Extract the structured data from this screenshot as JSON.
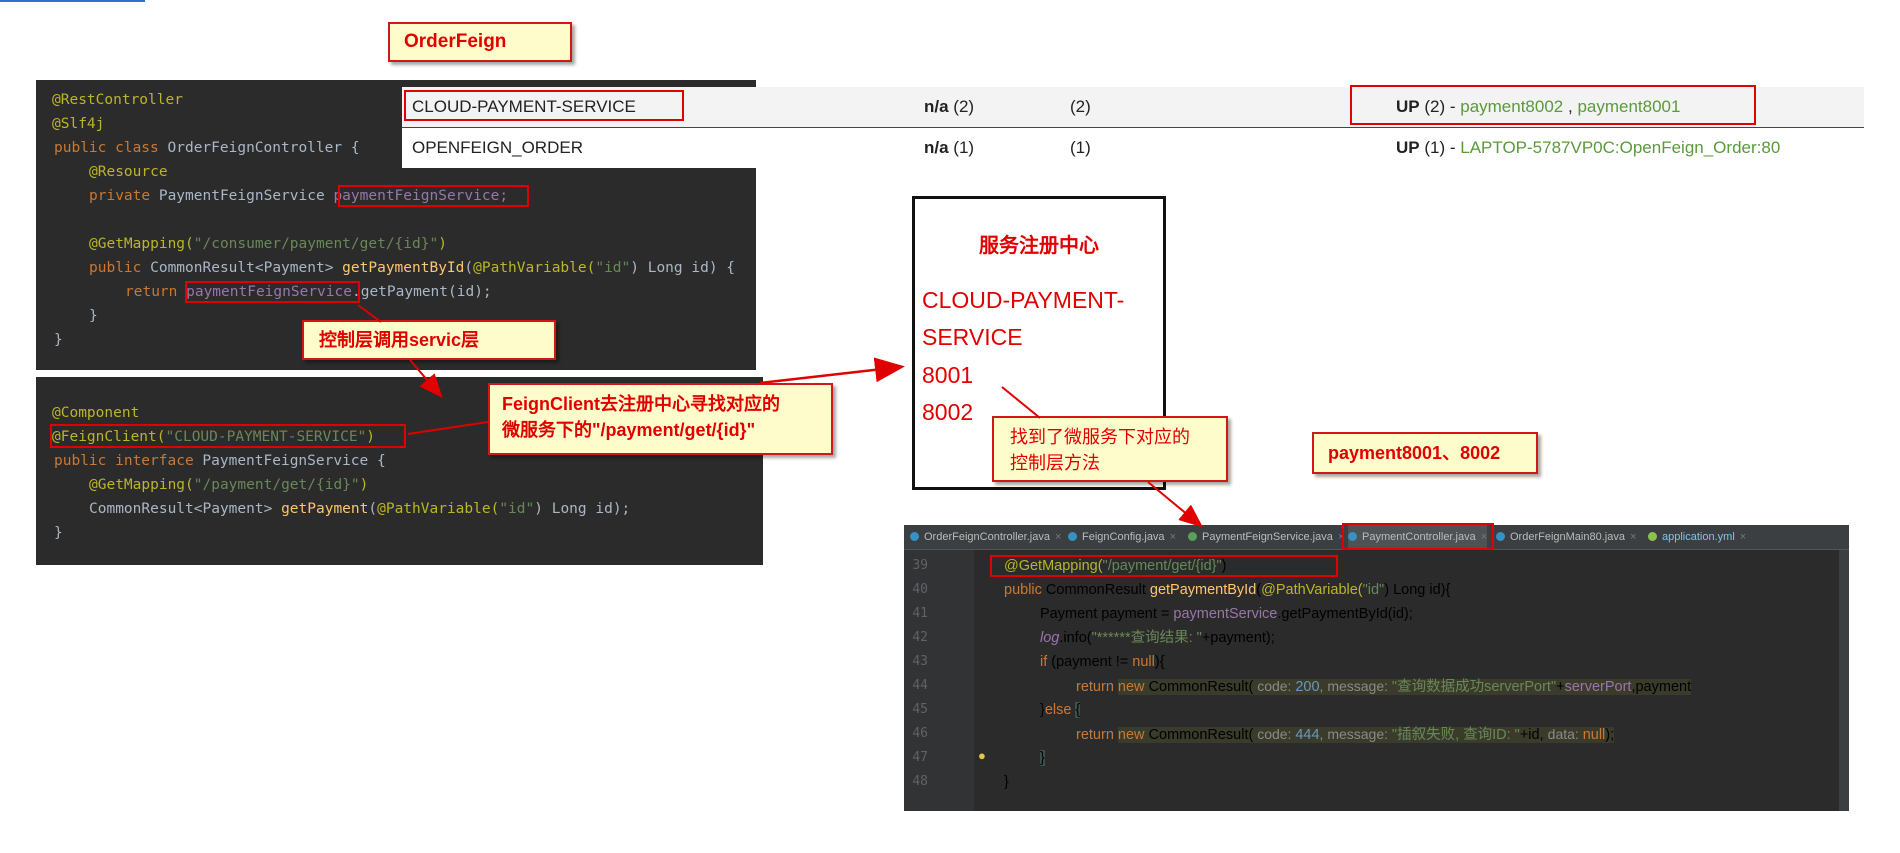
{
  "labels": {
    "order_feign": "OrderFeign",
    "controller_calls_service": "控制层调用servic层",
    "feignclient_note_1": "FeignClient去注册中心寻找对应的",
    "feignclient_note_2": "微服务下的\"/payment/get/{id}\"",
    "found_method_1": "找到了微服务下对应的",
    "found_method_2": "控制层方法",
    "payment_ports": "payment8001、8002"
  },
  "registry": {
    "title": "服务注册中心",
    "service_line1": "CLOUD-PAYMENT-",
    "service_line2": "SERVICE",
    "port1": "8001",
    "port2": "8002"
  },
  "eureka_table": {
    "rows": [
      {
        "app": "CLOUD-PAYMENT-SERVICE",
        "ami_bold": "n/a",
        "ami_count": " (2)",
        "zones": "(2)",
        "status_bold": "UP",
        "status_count": " (2) - ",
        "instance1": "payment8002",
        "separator": " , ",
        "instance2": "payment8001"
      },
      {
        "app": "OPENFEIGN_ORDER",
        "ami_bold": "n/a",
        "ami_count": " (1)",
        "zones": "(1)",
        "status_bold": "UP",
        "status_count": " (1) - ",
        "instance1": "LAPTOP-5787VP0C:OpenFeign_Order:80"
      }
    ]
  },
  "controller_code": {
    "l1": "@RestController",
    "l2": "@Slf4j",
    "l3_kw": "public class ",
    "l3_name": "OrderFeignController",
    "l3_end": " {",
    "l4": "@Resource",
    "l5_kw": "private ",
    "l5_type": "PaymentFeignService ",
    "l5_field": "paymentFeignService;",
    "l7_an": "@GetMapping(",
    "l7_str": "\"/consumer/payment/get/{id}\"",
    "l7_end": ")",
    "l8_kw": "public ",
    "l8_type": "CommonResult<Payment> ",
    "l8_fn": "getPaymentById",
    "l8_p1": "(",
    "l8_an": "@PathVariable(",
    "l8_str": "\"id\"",
    "l8_end": ") Long id) {",
    "l9_kw": "return ",
    "l9_field": "paymentFeignService",
    "l9_end": ".getPayment(id);",
    "l10": "}",
    "l11": "}"
  },
  "interface_code": {
    "l1": "@Component",
    "l2_an": "@FeignClient(",
    "l2_str": "\"CLOUD-PAYMENT-SERVICE\"",
    "l2_end": ")",
    "l3_kw": "public interface ",
    "l3_name": "PaymentFeignService {",
    "l4_an": "@GetMapping(",
    "l4_str": "\"/payment/get/{id}\"",
    "l4_end": ")",
    "l5_type": "CommonResult<Payment> ",
    "l5_fn": "getPayment",
    "l5_p1": "(",
    "l5_an": "@PathVariable(",
    "l5_str": "\"id\"",
    "l5_end": ") Long id);",
    "l6": "}"
  },
  "ide": {
    "tabs": [
      "OrderFeignController.java",
      "FeignConfig.java",
      "PaymentFeignService.java",
      "PaymentController.java",
      "OrderFeignMain80.java",
      "application.yml"
    ],
    "line_numbers": [
      "39",
      "40",
      "41",
      "42",
      "43",
      "44",
      "45",
      "46",
      "47",
      "48"
    ],
    "l39_an": "@GetMapping(",
    "l39_str": "\"/payment/get/{id}\"",
    "l39_end": ")",
    "l40_kw": "public ",
    "l40_type": "CommonResult ",
    "l40_fn": "getPaymentById",
    "l40_p1": "(",
    "l40_an": "@PathVariable(",
    "l40_str": "\"id\"",
    "l40_end": ") Long id){",
    "l41_a": "Payment payment = ",
    "l41_field": "paymentService",
    "l41_end": ".getPaymentById(id);",
    "l42_a": "log",
    "l42_b": ".info(",
    "l42_str": "\"******查询结果: \"",
    "l42_end": "+payment);",
    "l43_kw": "if ",
    "l43_a": "(payment != ",
    "l43_null": "null",
    "l43_end": "){",
    "l44_kw": "return ",
    "l44_new": "new ",
    "l44_cls": "CommonResult(",
    "l44_h1": " code: ",
    "l44_num": "200",
    "l44_h2": ", message: ",
    "l44_str": "\"查询数据成功serverPort\"",
    "l44_plus": "+",
    "l44_field": "serverPort",
    "l44_end": ",payment",
    "l45_a": "}",
    "l45_kw": "else ",
    "l45_b": "{",
    "l46_kw": "return ",
    "l46_new": "new ",
    "l46_cls": "CommonResult(",
    "l46_h1": " code: ",
    "l46_num": "444",
    "l46_h2": ", message: ",
    "l46_str": "\"插叙失败, 查询ID: \"",
    "l46_plus": "+id, ",
    "l46_h3": "data: ",
    "l46_null": "null",
    "l46_end": ");",
    "l47": "}",
    "l48": "}"
  },
  "colors": {
    "callout_border": "#d01818",
    "callout_fill": "#fffccc",
    "code_bg": "#2b2b2b",
    "link_green": "#5a9a3c"
  }
}
